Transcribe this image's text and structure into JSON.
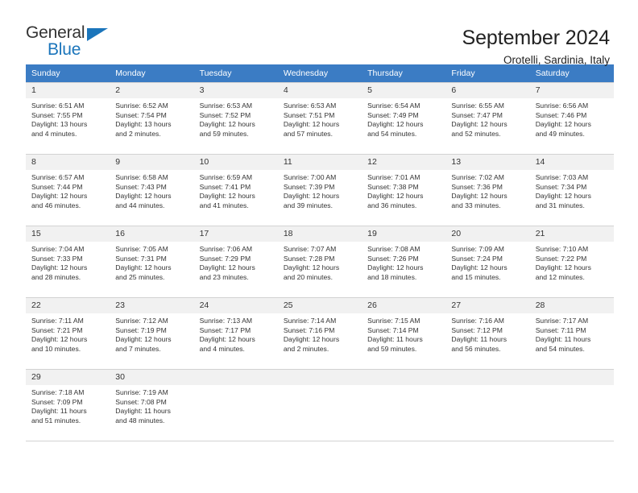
{
  "brand": {
    "name_part1": "General",
    "name_part2": "Blue",
    "accent_color": "#1b75bb"
  },
  "header": {
    "title": "September 2024",
    "subtitle": "Orotelli, Sardinia, Italy",
    "header_bg_color": "#3b7cc4"
  },
  "weekdays": [
    "Sunday",
    "Monday",
    "Tuesday",
    "Wednesday",
    "Thursday",
    "Friday",
    "Saturday"
  ],
  "weeks": [
    [
      {
        "day": "1",
        "sunrise": "Sunrise: 6:51 AM",
        "sunset": "Sunset: 7:55 PM",
        "daylight1": "Daylight: 13 hours",
        "daylight2": "and 4 minutes."
      },
      {
        "day": "2",
        "sunrise": "Sunrise: 6:52 AM",
        "sunset": "Sunset: 7:54 PM",
        "daylight1": "Daylight: 13 hours",
        "daylight2": "and 2 minutes."
      },
      {
        "day": "3",
        "sunrise": "Sunrise: 6:53 AM",
        "sunset": "Sunset: 7:52 PM",
        "daylight1": "Daylight: 12 hours",
        "daylight2": "and 59 minutes."
      },
      {
        "day": "4",
        "sunrise": "Sunrise: 6:53 AM",
        "sunset": "Sunset: 7:51 PM",
        "daylight1": "Daylight: 12 hours",
        "daylight2": "and 57 minutes."
      },
      {
        "day": "5",
        "sunrise": "Sunrise: 6:54 AM",
        "sunset": "Sunset: 7:49 PM",
        "daylight1": "Daylight: 12 hours",
        "daylight2": "and 54 minutes."
      },
      {
        "day": "6",
        "sunrise": "Sunrise: 6:55 AM",
        "sunset": "Sunset: 7:47 PM",
        "daylight1": "Daylight: 12 hours",
        "daylight2": "and 52 minutes."
      },
      {
        "day": "7",
        "sunrise": "Sunrise: 6:56 AM",
        "sunset": "Sunset: 7:46 PM",
        "daylight1": "Daylight: 12 hours",
        "daylight2": "and 49 minutes."
      }
    ],
    [
      {
        "day": "8",
        "sunrise": "Sunrise: 6:57 AM",
        "sunset": "Sunset: 7:44 PM",
        "daylight1": "Daylight: 12 hours",
        "daylight2": "and 46 minutes."
      },
      {
        "day": "9",
        "sunrise": "Sunrise: 6:58 AM",
        "sunset": "Sunset: 7:43 PM",
        "daylight1": "Daylight: 12 hours",
        "daylight2": "and 44 minutes."
      },
      {
        "day": "10",
        "sunrise": "Sunrise: 6:59 AM",
        "sunset": "Sunset: 7:41 PM",
        "daylight1": "Daylight: 12 hours",
        "daylight2": "and 41 minutes."
      },
      {
        "day": "11",
        "sunrise": "Sunrise: 7:00 AM",
        "sunset": "Sunset: 7:39 PM",
        "daylight1": "Daylight: 12 hours",
        "daylight2": "and 39 minutes."
      },
      {
        "day": "12",
        "sunrise": "Sunrise: 7:01 AM",
        "sunset": "Sunset: 7:38 PM",
        "daylight1": "Daylight: 12 hours",
        "daylight2": "and 36 minutes."
      },
      {
        "day": "13",
        "sunrise": "Sunrise: 7:02 AM",
        "sunset": "Sunset: 7:36 PM",
        "daylight1": "Daylight: 12 hours",
        "daylight2": "and 33 minutes."
      },
      {
        "day": "14",
        "sunrise": "Sunrise: 7:03 AM",
        "sunset": "Sunset: 7:34 PM",
        "daylight1": "Daylight: 12 hours",
        "daylight2": "and 31 minutes."
      }
    ],
    [
      {
        "day": "15",
        "sunrise": "Sunrise: 7:04 AM",
        "sunset": "Sunset: 7:33 PM",
        "daylight1": "Daylight: 12 hours",
        "daylight2": "and 28 minutes."
      },
      {
        "day": "16",
        "sunrise": "Sunrise: 7:05 AM",
        "sunset": "Sunset: 7:31 PM",
        "daylight1": "Daylight: 12 hours",
        "daylight2": "and 25 minutes."
      },
      {
        "day": "17",
        "sunrise": "Sunrise: 7:06 AM",
        "sunset": "Sunset: 7:29 PM",
        "daylight1": "Daylight: 12 hours",
        "daylight2": "and 23 minutes."
      },
      {
        "day": "18",
        "sunrise": "Sunrise: 7:07 AM",
        "sunset": "Sunset: 7:28 PM",
        "daylight1": "Daylight: 12 hours",
        "daylight2": "and 20 minutes."
      },
      {
        "day": "19",
        "sunrise": "Sunrise: 7:08 AM",
        "sunset": "Sunset: 7:26 PM",
        "daylight1": "Daylight: 12 hours",
        "daylight2": "and 18 minutes."
      },
      {
        "day": "20",
        "sunrise": "Sunrise: 7:09 AM",
        "sunset": "Sunset: 7:24 PM",
        "daylight1": "Daylight: 12 hours",
        "daylight2": "and 15 minutes."
      },
      {
        "day": "21",
        "sunrise": "Sunrise: 7:10 AM",
        "sunset": "Sunset: 7:22 PM",
        "daylight1": "Daylight: 12 hours",
        "daylight2": "and 12 minutes."
      }
    ],
    [
      {
        "day": "22",
        "sunrise": "Sunrise: 7:11 AM",
        "sunset": "Sunset: 7:21 PM",
        "daylight1": "Daylight: 12 hours",
        "daylight2": "and 10 minutes."
      },
      {
        "day": "23",
        "sunrise": "Sunrise: 7:12 AM",
        "sunset": "Sunset: 7:19 PM",
        "daylight1": "Daylight: 12 hours",
        "daylight2": "and 7 minutes."
      },
      {
        "day": "24",
        "sunrise": "Sunrise: 7:13 AM",
        "sunset": "Sunset: 7:17 PM",
        "daylight1": "Daylight: 12 hours",
        "daylight2": "and 4 minutes."
      },
      {
        "day": "25",
        "sunrise": "Sunrise: 7:14 AM",
        "sunset": "Sunset: 7:16 PM",
        "daylight1": "Daylight: 12 hours",
        "daylight2": "and 2 minutes."
      },
      {
        "day": "26",
        "sunrise": "Sunrise: 7:15 AM",
        "sunset": "Sunset: 7:14 PM",
        "daylight1": "Daylight: 11 hours",
        "daylight2": "and 59 minutes."
      },
      {
        "day": "27",
        "sunrise": "Sunrise: 7:16 AM",
        "sunset": "Sunset: 7:12 PM",
        "daylight1": "Daylight: 11 hours",
        "daylight2": "and 56 minutes."
      },
      {
        "day": "28",
        "sunrise": "Sunrise: 7:17 AM",
        "sunset": "Sunset: 7:11 PM",
        "daylight1": "Daylight: 11 hours",
        "daylight2": "and 54 minutes."
      }
    ],
    [
      {
        "day": "29",
        "sunrise": "Sunrise: 7:18 AM",
        "sunset": "Sunset: 7:09 PM",
        "daylight1": "Daylight: 11 hours",
        "daylight2": "and 51 minutes."
      },
      {
        "day": "30",
        "sunrise": "Sunrise: 7:19 AM",
        "sunset": "Sunset: 7:08 PM",
        "daylight1": "Daylight: 11 hours",
        "daylight2": "and 48 minutes."
      },
      {
        "day": "",
        "sunrise": "",
        "sunset": "",
        "daylight1": "",
        "daylight2": ""
      },
      {
        "day": "",
        "sunrise": "",
        "sunset": "",
        "daylight1": "",
        "daylight2": ""
      },
      {
        "day": "",
        "sunrise": "",
        "sunset": "",
        "daylight1": "",
        "daylight2": ""
      },
      {
        "day": "",
        "sunrise": "",
        "sunset": "",
        "daylight1": "",
        "daylight2": ""
      },
      {
        "day": "",
        "sunrise": "",
        "sunset": "",
        "daylight1": "",
        "daylight2": ""
      }
    ]
  ]
}
